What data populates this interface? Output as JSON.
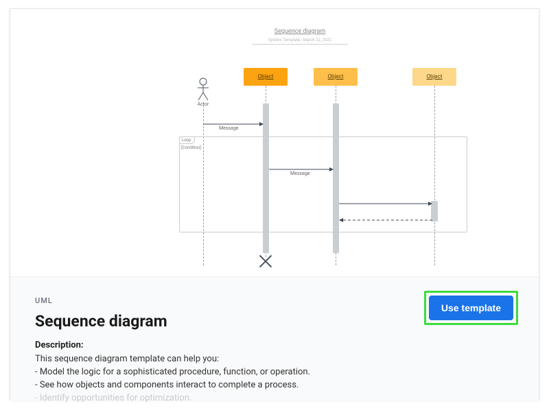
{
  "preview": {
    "title": "Sequence diagram",
    "subtitle": "System Template | March 22, 2022",
    "actor_label": "Actor",
    "objects": {
      "obj1": "Object",
      "obj2": "Object",
      "obj3": "Object"
    },
    "messages": {
      "msg1": "Message",
      "msg2": "Message"
    },
    "loop_label": "Loop",
    "condition_label": "[Condition]"
  },
  "info": {
    "category": "UML",
    "title": "Sequence diagram",
    "description_heading": "Description:",
    "lines": {
      "l0": "This sequence diagram template can help you:",
      "l1": "- Model the logic for a sophisticated procedure, function, or operation.",
      "l2": "- See how objects and components interact to complete a process.",
      "l3": "- Identify opportunities for optimization."
    },
    "use_button": "Use template"
  }
}
